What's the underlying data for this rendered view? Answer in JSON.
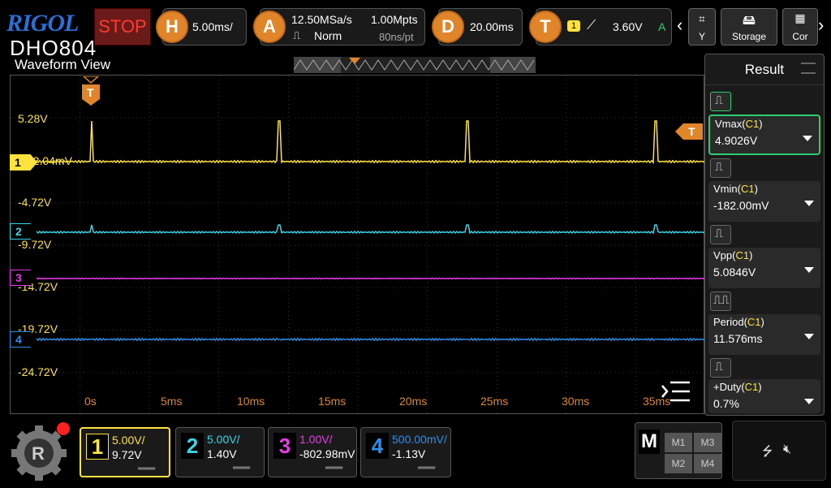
{
  "brand": {
    "logo": "RIGOL",
    "model": "DHO804"
  },
  "run_state": "STOP",
  "horizontal": {
    "key": "H",
    "timebase": "5.00ms/"
  },
  "acquire": {
    "key": "A",
    "sample_rate": "12.50MSa/s",
    "memory": "1.00Mpts",
    "mode": "Norm",
    "interval": "80ns/pt"
  },
  "delay": {
    "key": "D",
    "value": "20.00ms"
  },
  "trigger": {
    "key": "T",
    "source": "1",
    "level": "3.60V",
    "mode": "A"
  },
  "toolbar": {
    "storage_label": "Storage",
    "y_label": "Y",
    "cor_label": "Cor"
  },
  "waveform_view": {
    "title": "Waveform View",
    "y_labels": [
      "5.28V",
      "-4.72V",
      "-9.72V",
      "-14.72V",
      "-19.72V",
      "-24.72V"
    ],
    "ch1_readout": "-2.04mV",
    "x_labels": [
      "0s",
      "5ms",
      "10ms",
      "15ms",
      "20ms",
      "25ms",
      "30ms",
      "35ms"
    ],
    "trigger_marker": "T",
    "channel_markers": [
      "1",
      "2",
      "3",
      "4"
    ]
  },
  "result_panel": {
    "title": "Result",
    "items": [
      {
        "name": "Vmax",
        "src": "C1",
        "value": "4.9026V"
      },
      {
        "name": "Vmin",
        "src": "C1",
        "value": "-182.00mV"
      },
      {
        "name": "Vpp",
        "src": "C1",
        "value": "5.0846V"
      },
      {
        "name": "Period",
        "src": "C1",
        "value": "11.576ms"
      },
      {
        "name": "+Duty",
        "src": "C1",
        "value": "0.7%"
      }
    ]
  },
  "channels": [
    {
      "num": "1",
      "scale": "5.00V/",
      "offset": "9.72V",
      "color": "#ffe23d"
    },
    {
      "num": "2",
      "scale": "5.00V/",
      "offset": "1.40V",
      "color": "#37d6e8"
    },
    {
      "num": "3",
      "scale": "1.00V/",
      "offset": "-802.98mV",
      "color": "#e83ae8"
    },
    {
      "num": "4",
      "scale": "500.00mV/",
      "offset": "-1.13V",
      "color": "#2f8fe8"
    }
  ],
  "math": {
    "key": "M",
    "cells": [
      "M1",
      "M3",
      "M2",
      "M4"
    ]
  },
  "colors": {
    "accent": "#e0852a",
    "ch1": "#ffe23d",
    "ch2": "#37d6e8",
    "ch3": "#e83ae8",
    "ch4": "#2f8fe8",
    "selected": "#2ecc71",
    "stop": "#ff3b30"
  }
}
